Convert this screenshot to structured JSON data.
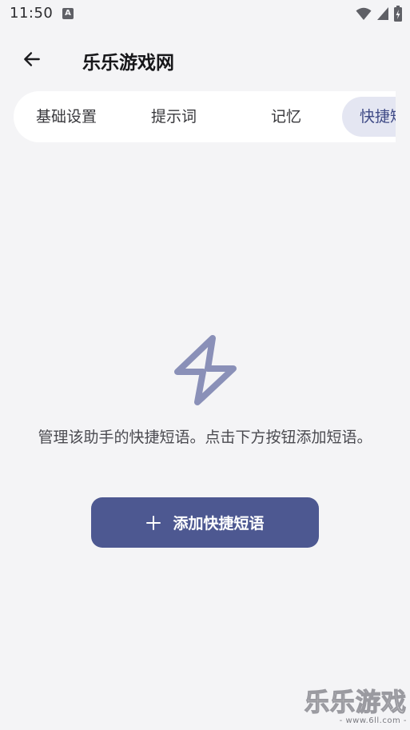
{
  "status_bar": {
    "time": "11:50",
    "notification_icon_letter": "A",
    "icons": [
      "wifi-icon",
      "cell-signal-icon",
      "battery-charging-icon"
    ]
  },
  "header": {
    "title": "乐乐游戏网",
    "back_icon": "arrow-left-icon"
  },
  "tabs": [
    {
      "label": "基础设置",
      "active": false
    },
    {
      "label": "提示词",
      "active": false
    },
    {
      "label": "记忆",
      "active": false
    },
    {
      "label": "快捷短语",
      "active": true
    }
  ],
  "empty_state": {
    "icon": "lightning-bolt-icon",
    "description": "管理该助手的快捷短语。点击下方按钮添加短语。"
  },
  "add_button": {
    "icon": "plus-icon",
    "label": "添加快捷短语"
  },
  "watermark": {
    "title": "乐乐游戏",
    "url": "- www.6ll.com -"
  },
  "colors": {
    "background": "#f4f4f6",
    "accent": "#4d5891",
    "active_tab_bg": "#e4e6f2",
    "active_tab_text": "#3f4a86",
    "empty_icon": "#8a90b8"
  }
}
